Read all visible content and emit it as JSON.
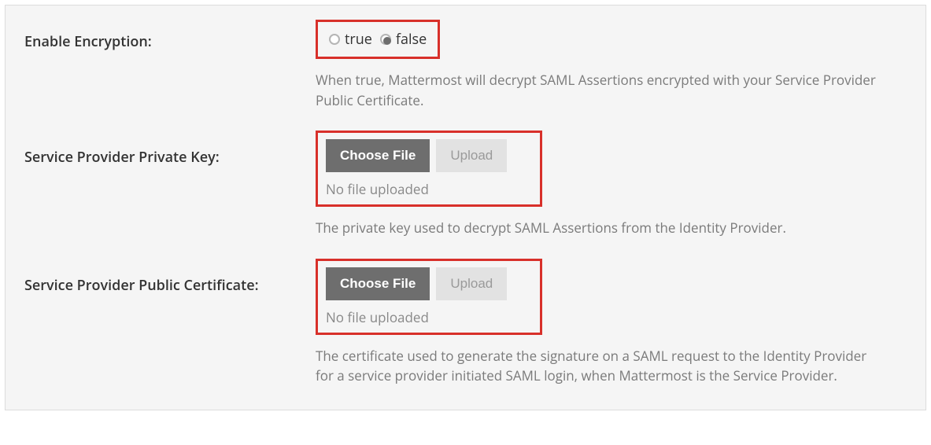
{
  "encryption": {
    "label": "Enable Encryption:",
    "options": {
      "true": "true",
      "false": "false"
    },
    "selected": "false",
    "help": "When true, Mattermost will decrypt SAML Assertions encrypted with your Service Provider Public Certificate."
  },
  "private_key": {
    "label": "Service Provider Private Key:",
    "choose": "Choose File",
    "upload": "Upload",
    "status": "No file uploaded",
    "help": "The private key used to decrypt SAML Assertions from the Identity Provider."
  },
  "public_cert": {
    "label": "Service Provider Public Certificate:",
    "choose": "Choose File",
    "upload": "Upload",
    "status": "No file uploaded",
    "help": "The certificate used to generate the signature on a SAML request to the Identity Provider for a service provider initiated SAML login, when Mattermost is the Service Provider."
  }
}
